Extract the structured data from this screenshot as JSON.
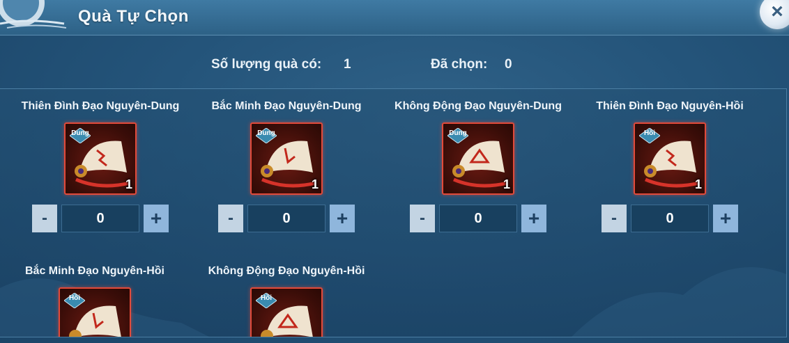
{
  "window": {
    "title": "Quà Tự Chọn",
    "close_label": "×"
  },
  "summary": {
    "available_label": "Số lượng quà có:",
    "available_value": "1",
    "chosen_label": "Đã chọn:",
    "chosen_value": "0"
  },
  "colors": {
    "frame_red": "#e24a3a",
    "plus_blue": "#8fb6dc",
    "minus_gray": "#c3d4e3"
  },
  "items": [
    {
      "name": "Thiên Đình Đạo Nguyên-Dung",
      "tag": "Dung",
      "count": "1",
      "minus": "-",
      "qty": "0",
      "plus": "+",
      "icon": "scroll-icon"
    },
    {
      "name": "Bắc Minh Đạo Nguyên-Dung",
      "tag": "Dung",
      "count": "1",
      "minus": "-",
      "qty": "0",
      "plus": "+",
      "icon": "scroll-icon"
    },
    {
      "name": "Không Động Đạo Nguyên-Dung",
      "tag": "Dung",
      "count": "1",
      "minus": "-",
      "qty": "0",
      "plus": "+",
      "icon": "scroll-icon"
    },
    {
      "name": "Thiên Đình Đạo Nguyên-Hồi",
      "tag": "Hồi",
      "count": "1",
      "minus": "-",
      "qty": "0",
      "plus": "+",
      "icon": "scroll-icon"
    },
    {
      "name": "Bắc Minh Đạo Nguyên-Hồi",
      "tag": "Hồi",
      "icon": "scroll-icon"
    },
    {
      "name": "Không Động Đạo Nguyên-Hồi",
      "tag": "Hồi",
      "icon": "scroll-icon"
    }
  ]
}
